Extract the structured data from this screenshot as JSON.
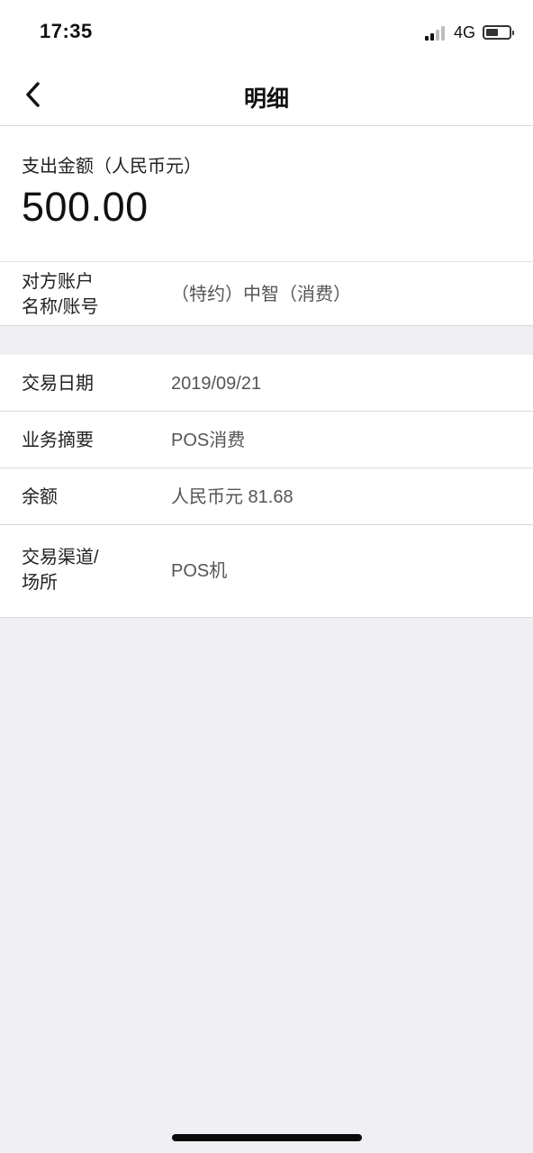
{
  "status_bar": {
    "time": "17:35",
    "network": "4G"
  },
  "nav": {
    "title": "明细",
    "back_icon": "chevron-left-icon"
  },
  "amount": {
    "label": "支出金额（人民币元）",
    "value": "500.00"
  },
  "counterparty": {
    "label_line1": "对方账户",
    "label_line2": "名称/账号",
    "value": "（特约）中智（消费）"
  },
  "details": [
    {
      "label": "交易日期",
      "value": "2019/09/21"
    },
    {
      "label": "业务摘要",
      "value": "POS消费"
    },
    {
      "label": "余额",
      "value": "人民币元 81.68"
    },
    {
      "label_line1": "交易渠道/",
      "label_line2": "场所",
      "value": "POS机"
    }
  ],
  "colors": {
    "page_background": "#efeff4",
    "card_background": "#ffffff",
    "divider": "#d9d9d9",
    "secondary_text": "#555555"
  }
}
